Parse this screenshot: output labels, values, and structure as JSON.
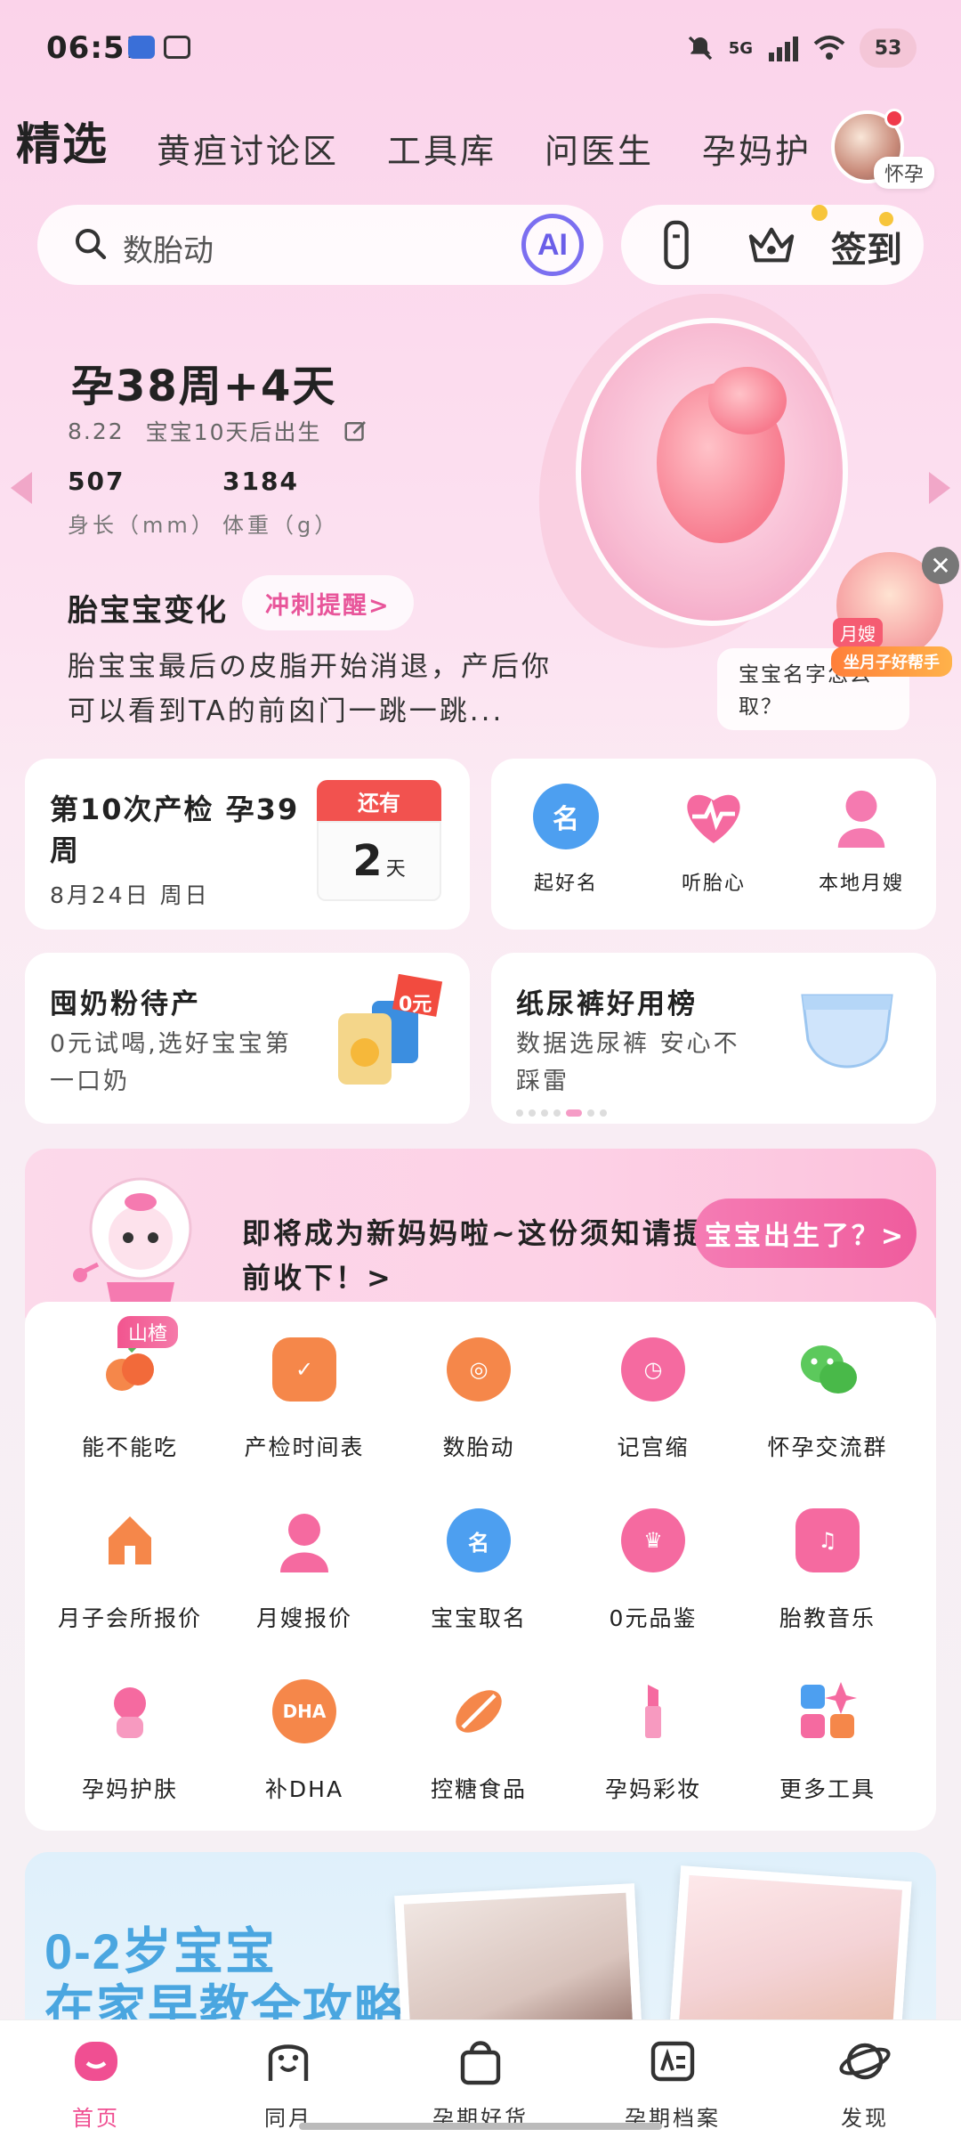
{
  "status_bar": {
    "time": "06:51",
    "network": "5G",
    "battery": "53"
  },
  "top_tabs": [
    {
      "label": "精选",
      "active": true
    },
    {
      "label": "黄疸讨论区"
    },
    {
      "label": "工具库"
    },
    {
      "label": "问医生"
    },
    {
      "label": "孕妈护"
    }
  ],
  "profile": {
    "badge": "怀孕"
  },
  "search": {
    "placeholder": "数胎动",
    "ai_label": "AI"
  },
  "toolbar": {
    "signin_label": "签到"
  },
  "pregnancy": {
    "week": "孕38周+4天",
    "date": "8.22",
    "countdown": "宝宝10天后出生",
    "length_value": "507",
    "length_label": "身长（mm）",
    "weight_value": "3184",
    "weight_label": "体重（g）",
    "section_title": "胎宝宝变化",
    "sprint_button": "冲刺提醒>",
    "description": "胎宝宝最后の皮脂开始消退，产后你可以看到TA的前囟门一跳一跳..."
  },
  "helper": {
    "bubble": "宝宝名字怎么取？",
    "tag": "月嫂",
    "label": "坐月子好帮手"
  },
  "exam_card": {
    "title": "第10次产检 孕39周",
    "date": "8月24日 周日",
    "calendar_head": "还有",
    "calendar_num": "2",
    "calendar_unit": "天"
  },
  "quick_actions": [
    {
      "label": "起好名",
      "icon": "name-icon",
      "color": "#4d9ff0"
    },
    {
      "label": "听胎心",
      "icon": "heartbeat-icon",
      "color": "#f56aa0"
    },
    {
      "label": "本地月嫂",
      "icon": "nanny-icon",
      "color": "#f57ab0"
    }
  ],
  "promos": [
    {
      "title": "囤奶粉待产",
      "subtitle": "0元试喝,选好宝宝第一口奶",
      "badge": "0元"
    },
    {
      "title": "纸尿裤好用榜",
      "subtitle": "数据选尿裤 安心不踩雷"
    }
  ],
  "banner": {
    "text": "即将成为新妈妈啦~这份须知请提前收下！>",
    "button": "宝宝出生了？>"
  },
  "tools": [
    {
      "label": "能不能吃",
      "icon": "food-icon",
      "color": "#f5874a",
      "tag": "山楂"
    },
    {
      "label": "产检时间表",
      "icon": "calendar-icon",
      "color": "#f5874a"
    },
    {
      "label": "数胎动",
      "icon": "fetal-icon",
      "color": "#f5874a"
    },
    {
      "label": "记宫缩",
      "icon": "timer-icon",
      "color": "#f56aa0"
    },
    {
      "label": "怀孕交流群",
      "icon": "chat-icon",
      "color": "#5cc95c"
    },
    {
      "label": "月子会所报价",
      "icon": "house-icon",
      "color": "#f5874a"
    },
    {
      "label": "月嫂报价",
      "icon": "nanny-icon",
      "color": "#f56aa0"
    },
    {
      "label": "宝宝取名",
      "icon": "name-icon",
      "color": "#4d9ff0"
    },
    {
      "label": "0元品鉴",
      "icon": "crown-icon",
      "color": "#f56aa0"
    },
    {
      "label": "胎教音乐",
      "icon": "music-icon",
      "color": "#f56aa0"
    },
    {
      "label": "孕妈护肤",
      "icon": "skincare-icon",
      "color": "#f56aa0"
    },
    {
      "label": "补DHA",
      "icon": "dha-icon",
      "color": "#f5874a"
    },
    {
      "label": "控糖食品",
      "icon": "leaf-icon",
      "color": "#f5874a"
    },
    {
      "label": "孕妈彩妆",
      "icon": "lipstick-icon",
      "color": "#f56aa0"
    },
    {
      "label": "更多工具",
      "icon": "grid-icon",
      "color": "#f56aa0"
    }
  ],
  "edu": {
    "title_line1": "0-2岁宝宝",
    "title_line2": "在家早教全攻略"
  },
  "bottom_nav": [
    {
      "label": "首页",
      "active": true
    },
    {
      "label": "同月"
    },
    {
      "label": "孕期好货"
    },
    {
      "label": "孕期档案"
    },
    {
      "label": "发现"
    }
  ],
  "colors": {
    "accent": "#f04f92",
    "ai": "#6a5ee8"
  }
}
